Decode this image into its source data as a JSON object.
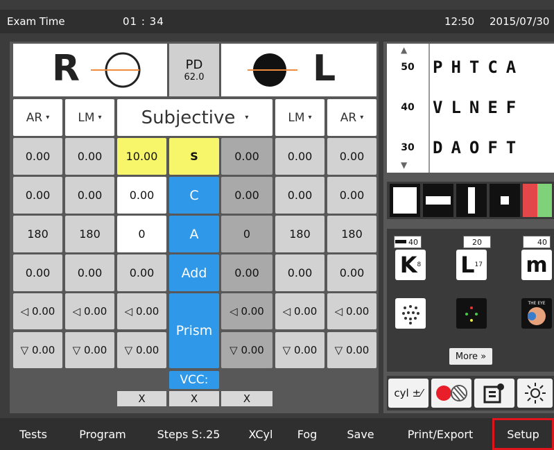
{
  "topbar": {
    "exam_time_label": "Exam Time",
    "exam_time_value": "01 : 34",
    "clock": "12:50",
    "date": "2015/07/30"
  },
  "eye_header": {
    "right_letter": "R",
    "left_letter": "L",
    "pd_label": "PD",
    "pd_value": "62.0"
  },
  "columns": {
    "ar_r": "AR",
    "lm_r": "LM",
    "subjective": "Subjective",
    "lm_l": "LM",
    "ar_l": "AR"
  },
  "rows": {
    "sphere": {
      "ar_r": "0.00",
      "lm_r": "0.00",
      "subj_r": "10.00",
      "label": "S",
      "subj_l": "0.00",
      "lm_l": "0.00",
      "ar_l": "0.00"
    },
    "cylinder": {
      "ar_r": "0.00",
      "lm_r": "0.00",
      "subj_r": "0.00",
      "label": "C",
      "subj_l": "0.00",
      "lm_l": "0.00",
      "ar_l": "0.00"
    },
    "axis": {
      "ar_r": "180",
      "lm_r": "180",
      "subj_r": "0",
      "label": "A",
      "subj_l": "0",
      "lm_l": "180",
      "ar_l": "180"
    },
    "add": {
      "ar_r": "0.00",
      "lm_r": "0.00",
      "subj_r": "0.00",
      "label": "Add",
      "subj_l": "0.00",
      "lm_l": "0.00",
      "ar_l": "0.00"
    },
    "prism_h": {
      "ar_r": "◁ 0.00",
      "lm_r": "◁ 0.00",
      "subj_r": "◁ 0.00",
      "subj_l": "◁ 0.00",
      "lm_l": "◁ 0.00",
      "ar_l": "◁ 0.00"
    },
    "prism_v": {
      "ar_r": "▽ 0.00",
      "lm_r": "▽ 0.00",
      "subj_r": "▽ 0.00",
      "subj_l": "▽ 0.00",
      "lm_l": "▽ 0.00",
      "ar_l": "▽ 0.00"
    },
    "prism_label": "Prism"
  },
  "vcc": {
    "label": "VCC:",
    "x1": "X",
    "x2": "X",
    "x3": "X"
  },
  "acuity_chart": {
    "rows": [
      {
        "size": "50",
        "letters": "PHTCA"
      },
      {
        "size": "40",
        "letters": "VLNEF"
      },
      {
        "size": "30",
        "letters": "DAOFT"
      }
    ]
  },
  "near_cards": {
    "card1": {
      "badge": "40",
      "glyph": "K",
      "sub": "8"
    },
    "card2": {
      "badge": "20",
      "glyph": "L",
      "sub": "17"
    },
    "card3": {
      "badge": "40",
      "glyph": "m"
    },
    "eye_label": "THE EYE",
    "more": "More »"
  },
  "tools": {
    "cyl": "cyl ±⁄"
  },
  "bottombar": {
    "tests": "Tests",
    "program": "Program",
    "steps": "Steps S:.25",
    "xcyl": "XCyl",
    "fog": "Fog",
    "save": "Save",
    "print": "Print/Export",
    "setup": "Setup"
  },
  "colors": {
    "accent_blue": "#2f98e8",
    "highlight_yellow": "#f7f56a",
    "setup_outline": "#e0141d"
  }
}
